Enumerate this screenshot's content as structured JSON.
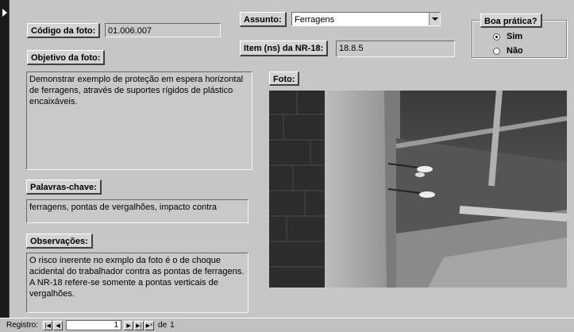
{
  "fields": {
    "codigo": {
      "label": "Código da foto:",
      "value": "01.006.007"
    },
    "assunto": {
      "label": "Assunto:",
      "value": "Ferragens"
    },
    "item_nr18": {
      "label": "Item (ns) da NR-18:",
      "value": "18.8.5"
    },
    "objetivo": {
      "label": "Objetivo da foto:",
      "value": "Demonstrar exemplo de proteção em espera horizontal de ferragens, através de suportes rígidos de plástico encaixáveis."
    },
    "palavras_chave": {
      "label": "Palavras-chave:",
      "value": "ferragens, pontas de vergalhões, impacto contra"
    },
    "observacoes": {
      "label": "Observações:",
      "value": "O risco inerente no exmplo da foto é o de choque acidental do trabalhador contra as pontas de ferragens. A NR-18 refere-se somente a pontas verticais de vergalhões."
    },
    "foto": {
      "label": "Foto:"
    }
  },
  "boa_pratica": {
    "label": "Boa prática?",
    "options": [
      {
        "label": "Sim",
        "selected": true
      },
      {
        "label": "Não",
        "selected": false
      }
    ]
  },
  "navigation": {
    "label": "Registro:",
    "current": "1",
    "of_label": "de",
    "total": "1",
    "first_icon": "first-record-icon",
    "prev_icon": "prev-record-icon",
    "next_icon": "next-record-icon",
    "last_icon": "last-record-icon",
    "new_icon": "new-record-icon"
  }
}
